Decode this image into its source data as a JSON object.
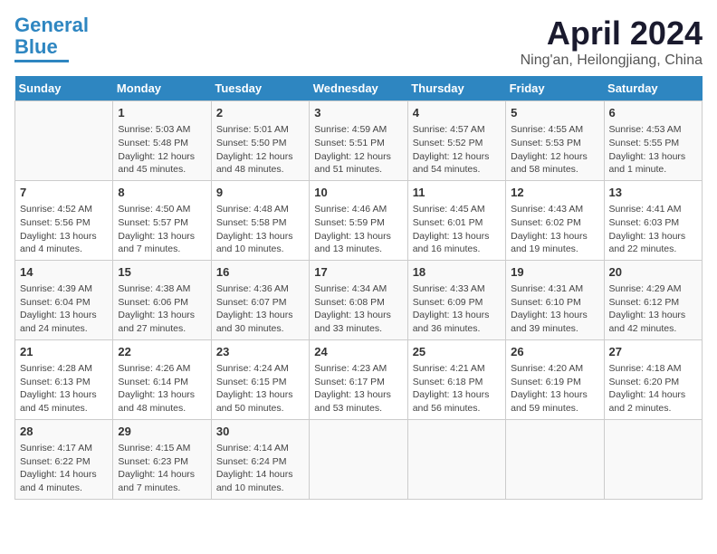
{
  "logo": {
    "line1": "General",
    "line2": "Blue"
  },
  "title": "April 2024",
  "location": "Ning'an, Heilongjiang, China",
  "days_of_week": [
    "Sunday",
    "Monday",
    "Tuesday",
    "Wednesday",
    "Thursday",
    "Friday",
    "Saturday"
  ],
  "weeks": [
    [
      {
        "day": "",
        "info": ""
      },
      {
        "day": "1",
        "info": "Sunrise: 5:03 AM\nSunset: 5:48 PM\nDaylight: 12 hours\nand 45 minutes."
      },
      {
        "day": "2",
        "info": "Sunrise: 5:01 AM\nSunset: 5:50 PM\nDaylight: 12 hours\nand 48 minutes."
      },
      {
        "day": "3",
        "info": "Sunrise: 4:59 AM\nSunset: 5:51 PM\nDaylight: 12 hours\nand 51 minutes."
      },
      {
        "day": "4",
        "info": "Sunrise: 4:57 AM\nSunset: 5:52 PM\nDaylight: 12 hours\nand 54 minutes."
      },
      {
        "day": "5",
        "info": "Sunrise: 4:55 AM\nSunset: 5:53 PM\nDaylight: 12 hours\nand 58 minutes."
      },
      {
        "day": "6",
        "info": "Sunrise: 4:53 AM\nSunset: 5:55 PM\nDaylight: 13 hours\nand 1 minute."
      }
    ],
    [
      {
        "day": "7",
        "info": "Sunrise: 4:52 AM\nSunset: 5:56 PM\nDaylight: 13 hours\nand 4 minutes."
      },
      {
        "day": "8",
        "info": "Sunrise: 4:50 AM\nSunset: 5:57 PM\nDaylight: 13 hours\nand 7 minutes."
      },
      {
        "day": "9",
        "info": "Sunrise: 4:48 AM\nSunset: 5:58 PM\nDaylight: 13 hours\nand 10 minutes."
      },
      {
        "day": "10",
        "info": "Sunrise: 4:46 AM\nSunset: 5:59 PM\nDaylight: 13 hours\nand 13 minutes."
      },
      {
        "day": "11",
        "info": "Sunrise: 4:45 AM\nSunset: 6:01 PM\nDaylight: 13 hours\nand 16 minutes."
      },
      {
        "day": "12",
        "info": "Sunrise: 4:43 AM\nSunset: 6:02 PM\nDaylight: 13 hours\nand 19 minutes."
      },
      {
        "day": "13",
        "info": "Sunrise: 4:41 AM\nSunset: 6:03 PM\nDaylight: 13 hours\nand 22 minutes."
      }
    ],
    [
      {
        "day": "14",
        "info": "Sunrise: 4:39 AM\nSunset: 6:04 PM\nDaylight: 13 hours\nand 24 minutes."
      },
      {
        "day": "15",
        "info": "Sunrise: 4:38 AM\nSunset: 6:06 PM\nDaylight: 13 hours\nand 27 minutes."
      },
      {
        "day": "16",
        "info": "Sunrise: 4:36 AM\nSunset: 6:07 PM\nDaylight: 13 hours\nand 30 minutes."
      },
      {
        "day": "17",
        "info": "Sunrise: 4:34 AM\nSunset: 6:08 PM\nDaylight: 13 hours\nand 33 minutes."
      },
      {
        "day": "18",
        "info": "Sunrise: 4:33 AM\nSunset: 6:09 PM\nDaylight: 13 hours\nand 36 minutes."
      },
      {
        "day": "19",
        "info": "Sunrise: 4:31 AM\nSunset: 6:10 PM\nDaylight: 13 hours\nand 39 minutes."
      },
      {
        "day": "20",
        "info": "Sunrise: 4:29 AM\nSunset: 6:12 PM\nDaylight: 13 hours\nand 42 minutes."
      }
    ],
    [
      {
        "day": "21",
        "info": "Sunrise: 4:28 AM\nSunset: 6:13 PM\nDaylight: 13 hours\nand 45 minutes."
      },
      {
        "day": "22",
        "info": "Sunrise: 4:26 AM\nSunset: 6:14 PM\nDaylight: 13 hours\nand 48 minutes."
      },
      {
        "day": "23",
        "info": "Sunrise: 4:24 AM\nSunset: 6:15 PM\nDaylight: 13 hours\nand 50 minutes."
      },
      {
        "day": "24",
        "info": "Sunrise: 4:23 AM\nSunset: 6:17 PM\nDaylight: 13 hours\nand 53 minutes."
      },
      {
        "day": "25",
        "info": "Sunrise: 4:21 AM\nSunset: 6:18 PM\nDaylight: 13 hours\nand 56 minutes."
      },
      {
        "day": "26",
        "info": "Sunrise: 4:20 AM\nSunset: 6:19 PM\nDaylight: 13 hours\nand 59 minutes."
      },
      {
        "day": "27",
        "info": "Sunrise: 4:18 AM\nSunset: 6:20 PM\nDaylight: 14 hours\nand 2 minutes."
      }
    ],
    [
      {
        "day": "28",
        "info": "Sunrise: 4:17 AM\nSunset: 6:22 PM\nDaylight: 14 hours\nand 4 minutes."
      },
      {
        "day": "29",
        "info": "Sunrise: 4:15 AM\nSunset: 6:23 PM\nDaylight: 14 hours\nand 7 minutes."
      },
      {
        "day": "30",
        "info": "Sunrise: 4:14 AM\nSunset: 6:24 PM\nDaylight: 14 hours\nand 10 minutes."
      },
      {
        "day": "",
        "info": ""
      },
      {
        "day": "",
        "info": ""
      },
      {
        "day": "",
        "info": ""
      },
      {
        "day": "",
        "info": ""
      }
    ]
  ]
}
